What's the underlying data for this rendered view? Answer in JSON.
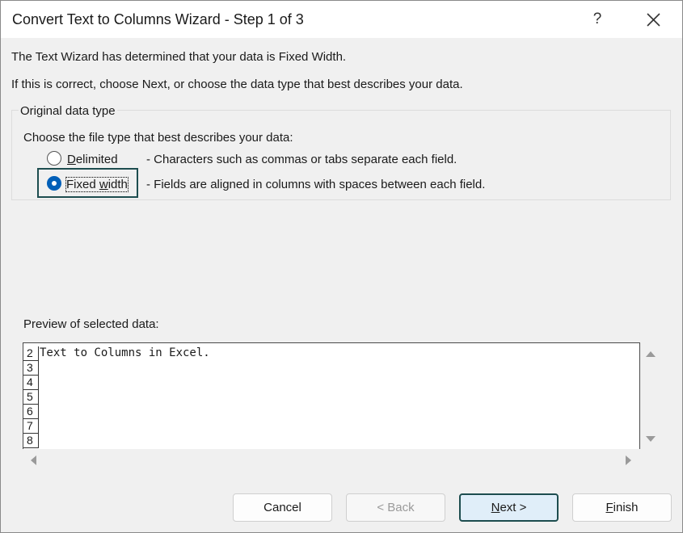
{
  "window": {
    "title": "Convert Text to Columns Wizard - Step 1 of 3",
    "help_label": "?"
  },
  "intro": {
    "line1": "The Text Wizard has determined that your data is Fixed Width.",
    "line2": "If this is correct, choose Next, or choose the data type that best describes your data."
  },
  "group": {
    "legend": "Original data type",
    "prompt": "Choose the file type that best describes your data:",
    "options": [
      {
        "label_pre": "",
        "label_ul": "D",
        "label_post": "elimited",
        "description": "- Characters such as commas or tabs separate each field.",
        "selected": false
      },
      {
        "label_pre": "Fixed ",
        "label_ul": "w",
        "label_post": "idth",
        "description": "- Fields are aligned in columns with spaces between each field.",
        "selected": true
      }
    ]
  },
  "preview": {
    "label": "Preview of selected data:",
    "rows": [
      {
        "num": "2",
        "text": "Text to Columns in Excel."
      },
      {
        "num": "3",
        "text": ""
      },
      {
        "num": "4",
        "text": ""
      },
      {
        "num": "5",
        "text": ""
      },
      {
        "num": "6",
        "text": ""
      },
      {
        "num": "7",
        "text": ""
      },
      {
        "num": "8",
        "text": ""
      }
    ]
  },
  "buttons": {
    "cancel": "Cancel",
    "back": "< Back",
    "next_ul": "N",
    "next_rest": "ext >",
    "finish_ul": "F",
    "finish_rest": "inish"
  },
  "colors": {
    "accent": "#005fb8",
    "focus_border": "#1d4d4f"
  }
}
